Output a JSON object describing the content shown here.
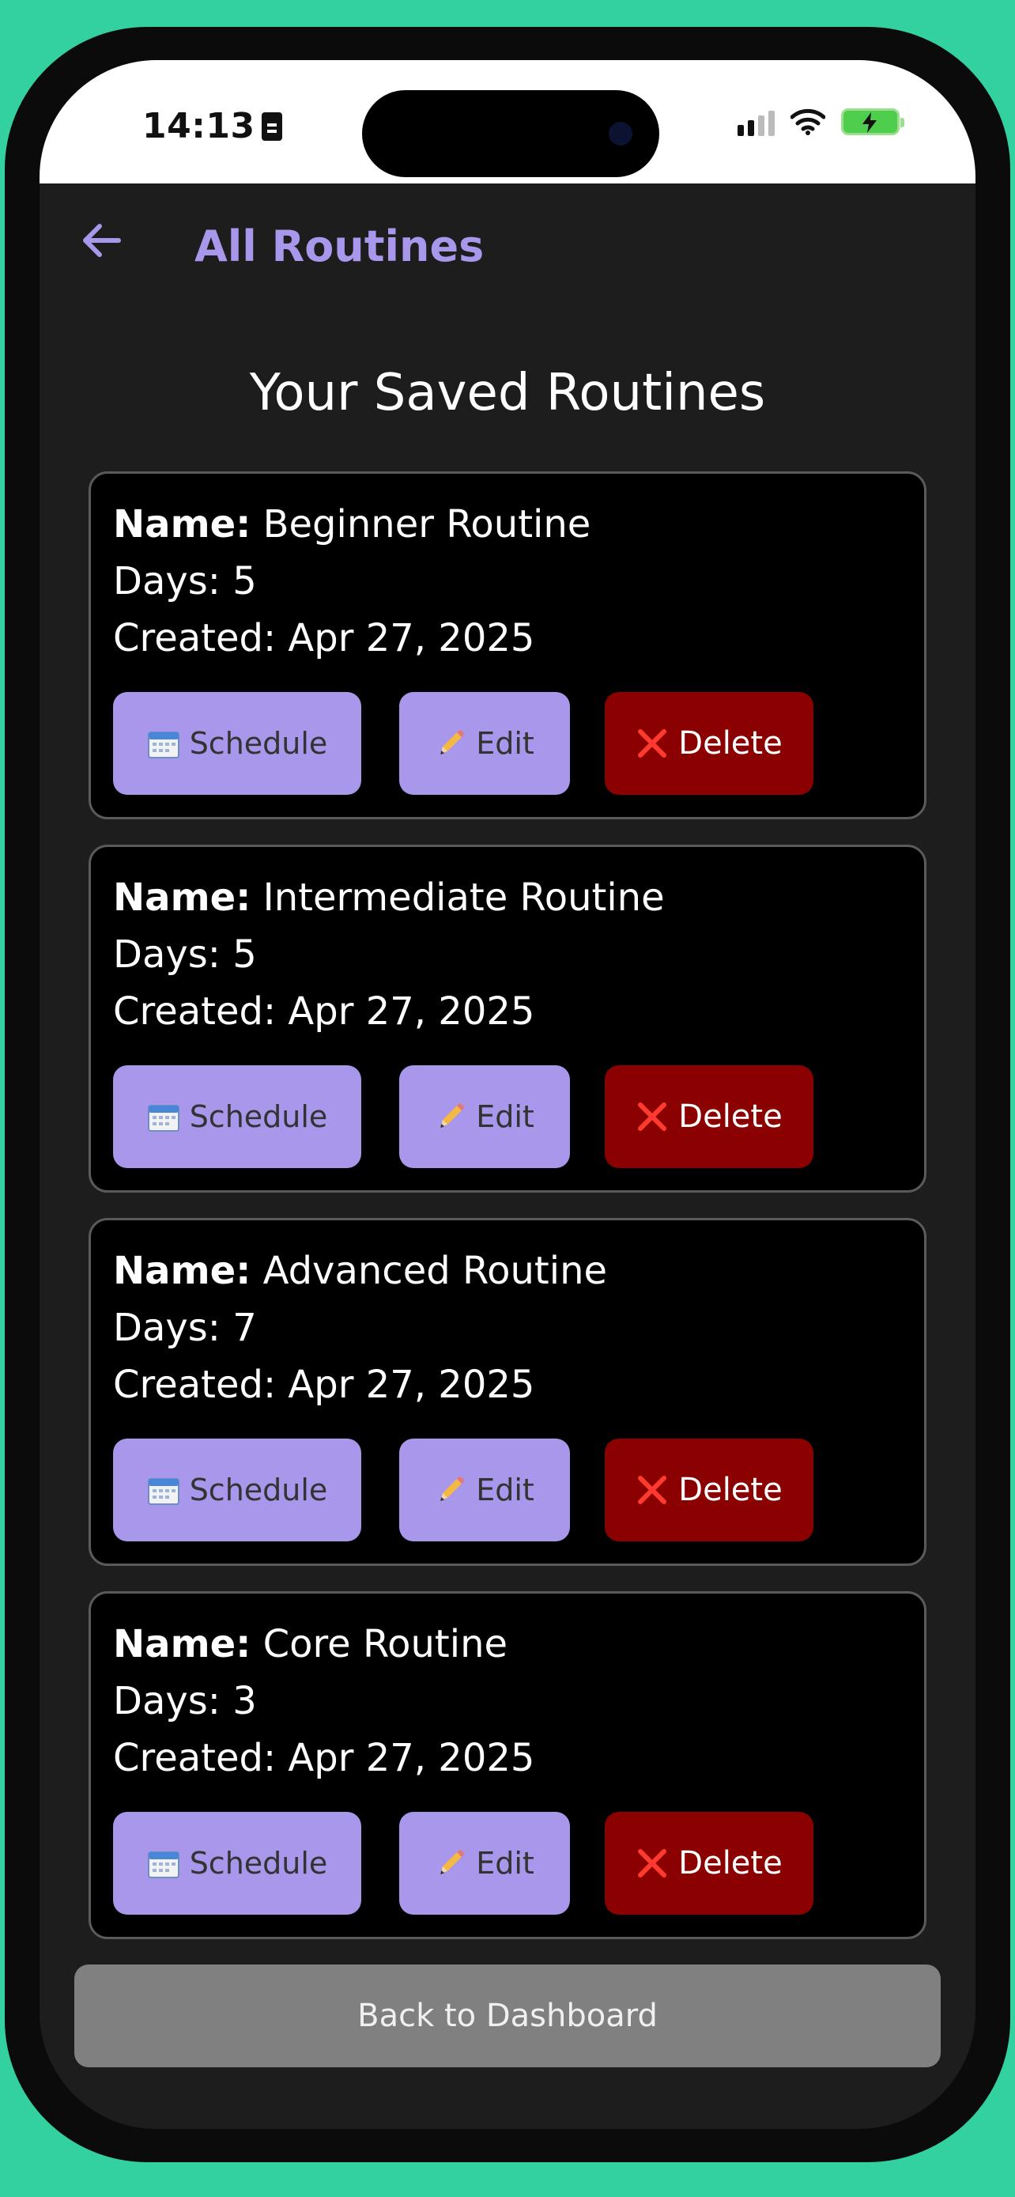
{
  "status_bar": {
    "time": "14:13"
  },
  "header": {
    "title": "All Routines",
    "back_icon": "arrow-left-icon"
  },
  "page": {
    "heading": "Your Saved Routines"
  },
  "labels": {
    "name": "Name:",
    "days": "Days:",
    "created": "Created:"
  },
  "actions": {
    "schedule": "Schedule",
    "edit": "Edit",
    "delete": "Delete"
  },
  "routines": [
    {
      "name": "Beginner Routine",
      "days": "5",
      "created": "Apr 27, 2025"
    },
    {
      "name": "Intermediate Routine",
      "days": "5",
      "created": "Apr 27, 2025"
    },
    {
      "name": "Advanced Routine",
      "days": "7",
      "created": "Apr 27, 2025"
    },
    {
      "name": "Core Routine",
      "days": "3",
      "created": "Apr 27, 2025"
    }
  ],
  "footer": {
    "back_label": "Back to Dashboard"
  },
  "colors": {
    "background": "#34D1A0",
    "screen": "#1D1D1D",
    "accent": "#A897EA",
    "danger": "#8B0000",
    "neutral_button": "#808080"
  }
}
